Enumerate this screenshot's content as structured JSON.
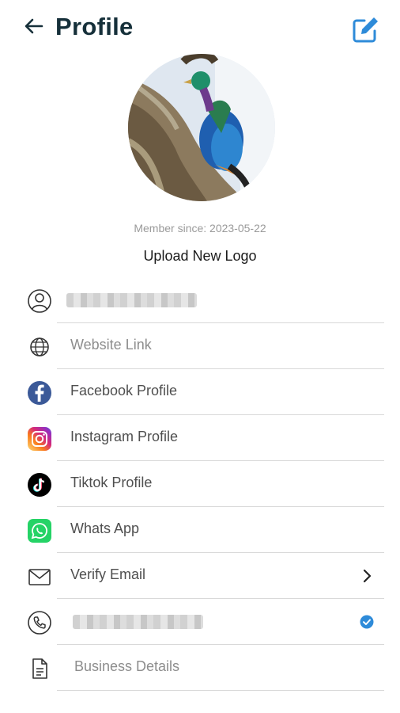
{
  "header": {
    "title": "Profile"
  },
  "profile": {
    "member_since": "Member since: 2023-05-22",
    "upload_label": "Upload New Logo"
  },
  "icons": {
    "back": "arrow-left-icon",
    "edit": "edit-square-icon",
    "user": "user-circle-icon",
    "globe": "globe-icon",
    "facebook": "facebook-icon",
    "instagram": "instagram-icon",
    "tiktok": "tiktok-icon",
    "whatsapp": "whatsapp-icon",
    "email": "mail-icon",
    "phone": "phone-icon",
    "document": "document-icon",
    "chevron": "chevron-right-icon",
    "verified": "check-circle-icon"
  },
  "items": {
    "website": "Website Link",
    "facebook": "Facebook Profile",
    "instagram": "Instagram Profile",
    "tiktok": "Tiktok Profile",
    "whatsapp": "Whats App",
    "email": "Verify Email",
    "business": "Business Details"
  },
  "colors": {
    "title": "#16303a",
    "accent": "#2e8bd9",
    "facebook": "#3b5998",
    "whatsapp": "#25d366",
    "tiktok": "#000000"
  }
}
